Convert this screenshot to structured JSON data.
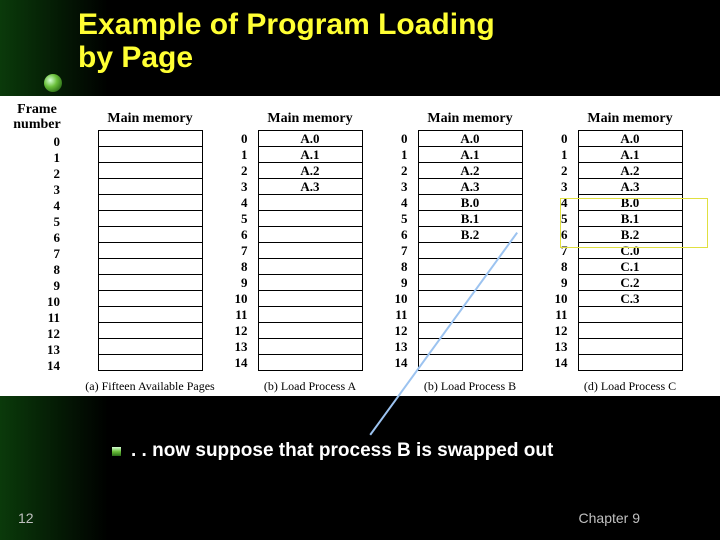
{
  "title_line1": "Example of Program Loading",
  "title_line2": "by Page",
  "frame_header_l1": "Frame",
  "frame_header_l2": "number",
  "memory_header": "Main memory",
  "frames": [
    "0",
    "1",
    "2",
    "3",
    "4",
    "5",
    "6",
    "7",
    "8",
    "9",
    "10",
    "11",
    "12",
    "13",
    "14"
  ],
  "columns": [
    {
      "caption": "(a) Fifteen Available Pages",
      "cells": [
        "",
        "",
        "",
        "",
        "",
        "",
        "",
        "",
        "",
        "",
        "",
        "",
        "",
        "",
        ""
      ]
    },
    {
      "caption": "(b) Load Process A",
      "cells": [
        "A.0",
        "A.1",
        "A.2",
        "A.3",
        "",
        "",
        "",
        "",
        "",
        "",
        "",
        "",
        "",
        "",
        ""
      ]
    },
    {
      "caption": "(b) Load Process B",
      "cells": [
        "A.0",
        "A.1",
        "A.2",
        "A.3",
        "B.0",
        "B.1",
        "B.2",
        "",
        "",
        "",
        "",
        "",
        "",
        "",
        ""
      ]
    },
    {
      "caption": "(d) Load Process C",
      "cells": [
        "A.0",
        "A.1",
        "A.2",
        "A.3",
        "B.0",
        "B.1",
        "B.2",
        "C.0",
        "C.1",
        "C.2",
        "C.3",
        "",
        "",
        "",
        ""
      ]
    }
  ],
  "bullet_text": ". . now suppose that process B is swapped out",
  "slide_number": "12",
  "chapter_label": "Chapter 9",
  "chart_data": {
    "type": "table",
    "title": "Example of Program Loading by Page",
    "frames": [
      0,
      1,
      2,
      3,
      4,
      5,
      6,
      7,
      8,
      9,
      10,
      11,
      12,
      13,
      14
    ],
    "states": [
      {
        "label": "(a) Fifteen Available Pages",
        "contents": [
          null,
          null,
          null,
          null,
          null,
          null,
          null,
          null,
          null,
          null,
          null,
          null,
          null,
          null,
          null
        ]
      },
      {
        "label": "(b) Load Process A",
        "contents": [
          "A.0",
          "A.1",
          "A.2",
          "A.3",
          null,
          null,
          null,
          null,
          null,
          null,
          null,
          null,
          null,
          null,
          null
        ]
      },
      {
        "label": "(b) Load Process B",
        "contents": [
          "A.0",
          "A.1",
          "A.2",
          "A.3",
          "B.0",
          "B.1",
          "B.2",
          null,
          null,
          null,
          null,
          null,
          null,
          null,
          null
        ]
      },
      {
        "label": "(d) Load Process C",
        "contents": [
          "A.0",
          "A.1",
          "A.2",
          "A.3",
          "B.0",
          "B.1",
          "B.2",
          "C.0",
          "C.1",
          "C.2",
          "C.3",
          null,
          null,
          null,
          null
        ]
      }
    ],
    "highlight": {
      "state_index": 3,
      "frames": [
        4,
        5,
        6
      ],
      "note": "process B pages highlighted, to be swapped out"
    }
  }
}
